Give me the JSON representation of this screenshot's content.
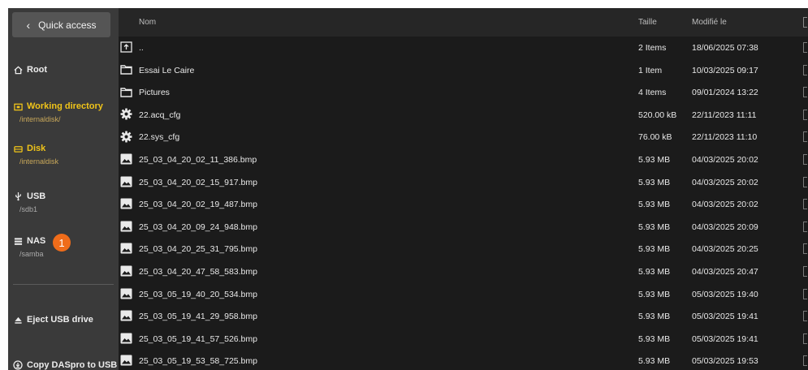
{
  "sidebar": {
    "quick_access": {
      "label": "Quick access",
      "icon": "chevron-left-icon"
    },
    "items": [
      {
        "label": "Root",
        "sub": "",
        "icon": "home-icon",
        "color": "#ececec"
      },
      {
        "label": "Working directory",
        "sub": "/internaldisk/",
        "icon": "folder-icon",
        "color": "#f0c419"
      },
      {
        "label": "Disk",
        "sub": "/internaldisk",
        "icon": "disk-icon",
        "color": "#f0c419"
      },
      {
        "label": "USB",
        "sub": "/sdb1",
        "icon": "usb-icon",
        "color": "#ececec"
      },
      {
        "label": "NAS",
        "sub": "/samba",
        "icon": "nas-icon",
        "color": "#ececec"
      }
    ],
    "badge": "1",
    "actions": [
      {
        "label": "Eject USB drive",
        "icon": "eject-icon"
      },
      {
        "label": "Copy DASpro to USB",
        "icon": "copy-icon"
      }
    ]
  },
  "table": {
    "columns": {
      "name": "Nom",
      "size": "Taille",
      "modified": "Modifié le"
    },
    "rows": [
      {
        "icon": "parent-folder-icon",
        "name": "..",
        "size": "2 Items",
        "date": "18/06/2025 07:38"
      },
      {
        "icon": "folder-icon",
        "name": "Essai Le Caire",
        "size": "1 Item",
        "date": "10/03/2025 09:17"
      },
      {
        "icon": "folder-icon",
        "name": "Pictures",
        "size": "4 Items",
        "date": "09/01/2024 13:22"
      },
      {
        "icon": "gear-icon",
        "name": "22.acq_cfg",
        "size": "520.00 kB",
        "date": "22/11/2023 11:11"
      },
      {
        "icon": "gear-icon",
        "name": "22.sys_cfg",
        "size": "76.00 kB",
        "date": "22/11/2023 11:10"
      },
      {
        "icon": "image-icon",
        "name": "25_03_04_20_02_11_386.bmp",
        "size": "5.93 MB",
        "date": "04/03/2025 20:02"
      },
      {
        "icon": "image-icon",
        "name": "25_03_04_20_02_15_917.bmp",
        "size": "5.93 MB",
        "date": "04/03/2025 20:02"
      },
      {
        "icon": "image-icon",
        "name": "25_03_04_20_02_19_487.bmp",
        "size": "5.93 MB",
        "date": "04/03/2025 20:02"
      },
      {
        "icon": "image-icon",
        "name": "25_03_04_20_09_24_948.bmp",
        "size": "5.93 MB",
        "date": "04/03/2025 20:09"
      },
      {
        "icon": "image-icon",
        "name": "25_03_04_20_25_31_795.bmp",
        "size": "5.93 MB",
        "date": "04/03/2025 20:25"
      },
      {
        "icon": "image-icon",
        "name": "25_03_04_20_47_58_583.bmp",
        "size": "5.93 MB",
        "date": "04/03/2025 20:47"
      },
      {
        "icon": "image-icon",
        "name": "25_03_05_19_40_20_534.bmp",
        "size": "5.93 MB",
        "date": "05/03/2025 19:40"
      },
      {
        "icon": "image-icon",
        "name": "25_03_05_19_41_29_958.bmp",
        "size": "5.93 MB",
        "date": "05/03/2025 19:41"
      },
      {
        "icon": "image-icon",
        "name": "25_03_05_19_41_57_526.bmp",
        "size": "5.93 MB",
        "date": "05/03/2025 19:41"
      },
      {
        "icon": "image-icon",
        "name": "25_03_05_19_53_58_725.bmp",
        "size": "5.93 MB",
        "date": "05/03/2025 19:53"
      }
    ]
  },
  "colors": {
    "accent_yellow": "#f0c419",
    "badge_orange": "#ef6c1a",
    "sidebar_bg": "#3a3a3a",
    "list_bg": "#1b1b1b"
  }
}
